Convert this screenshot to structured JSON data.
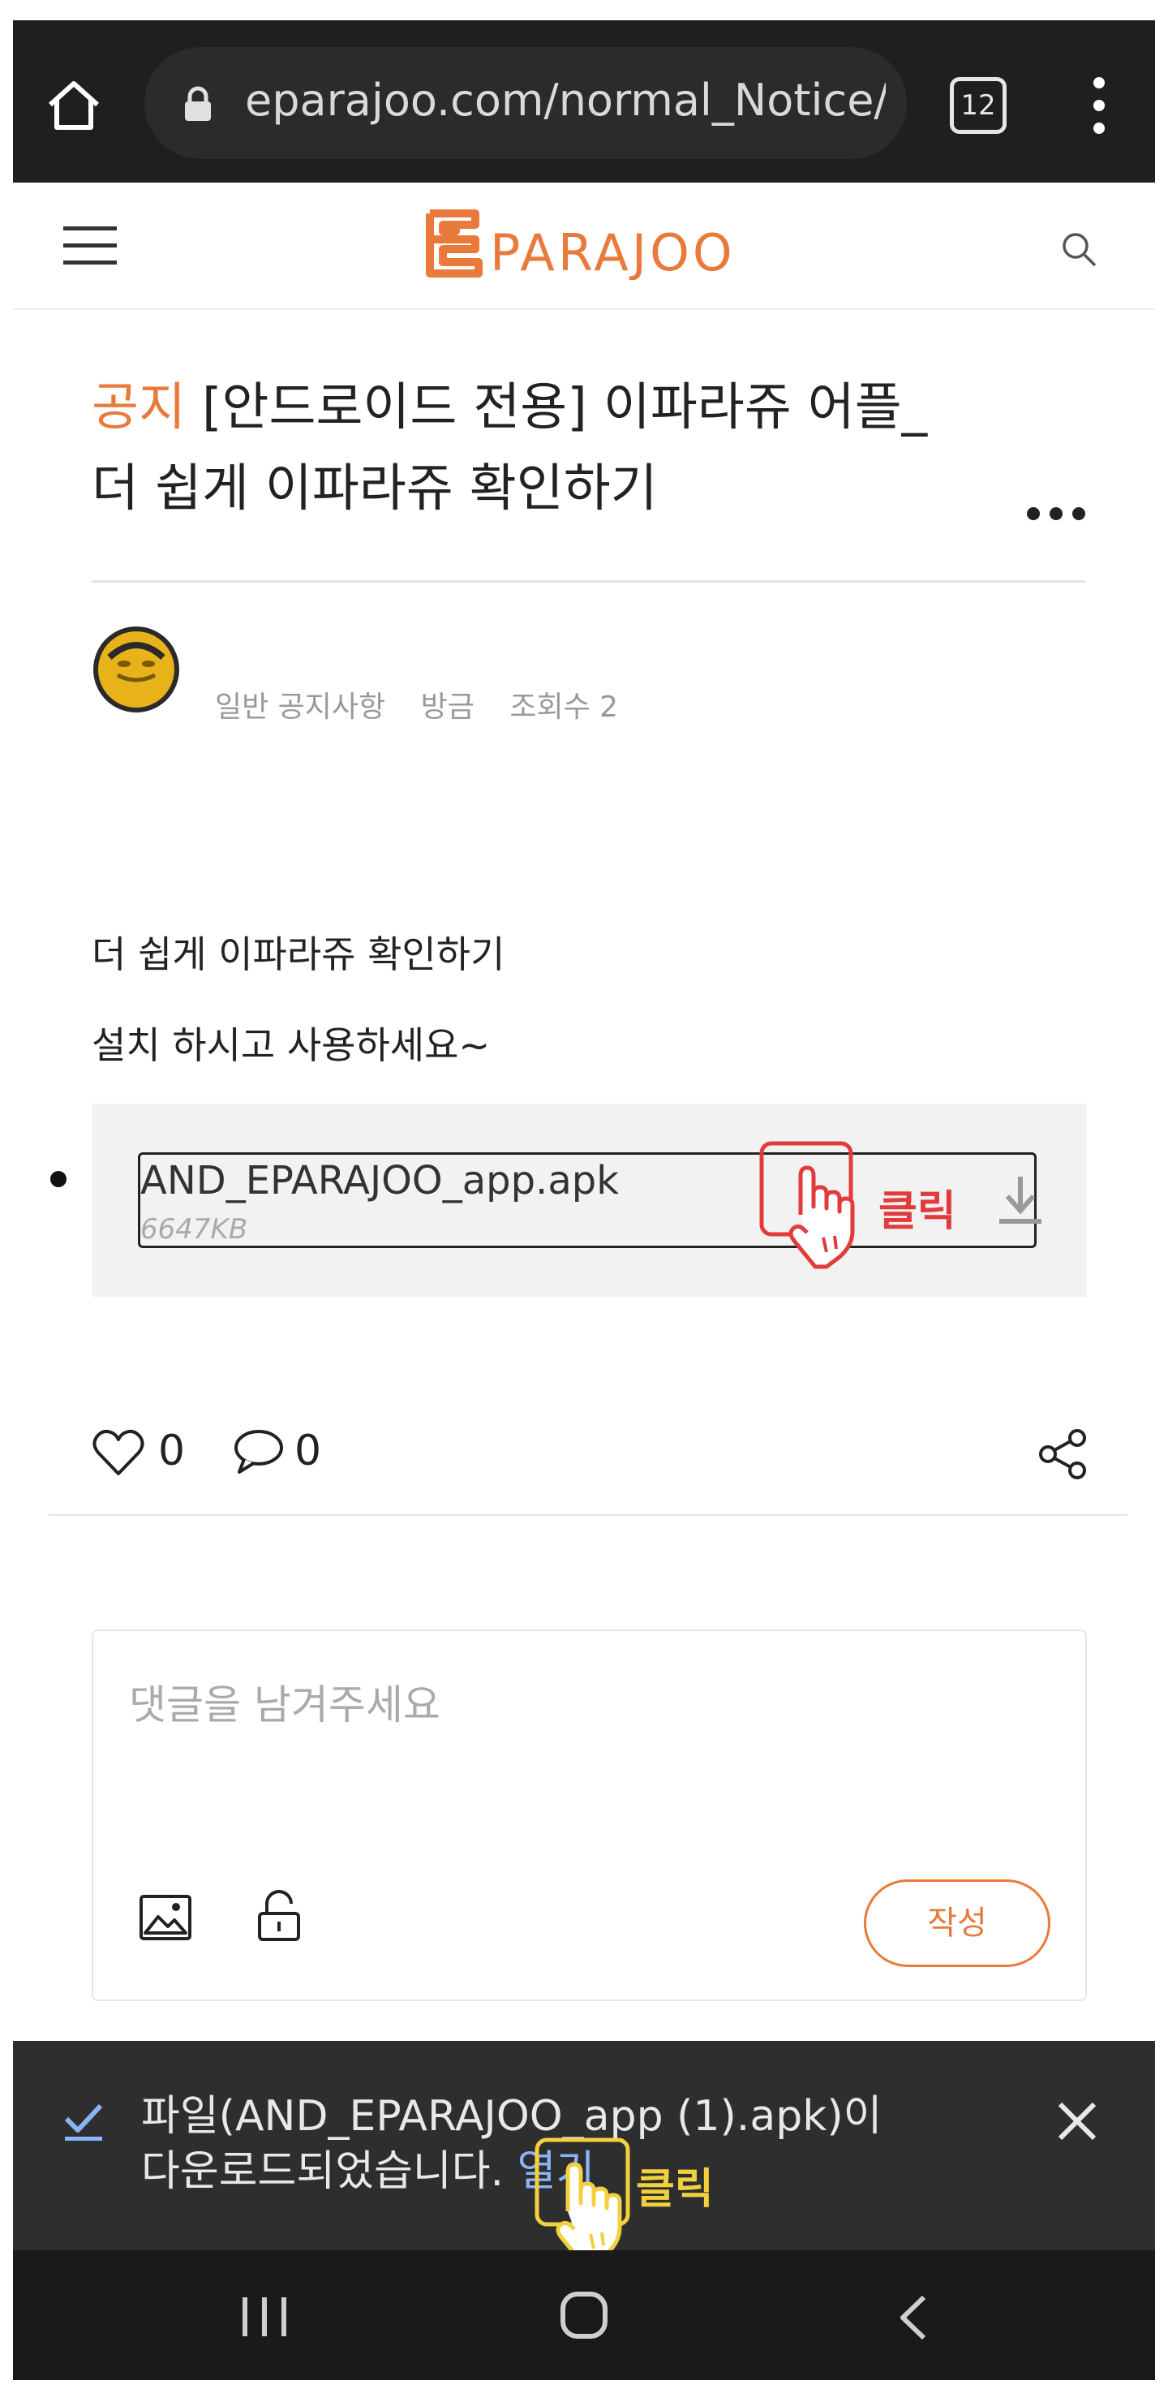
{
  "browser": {
    "url": "eparajoo.com/normal_Notice/",
    "tab_count": "12"
  },
  "site": {
    "logo_text": "EPARAJOO"
  },
  "post": {
    "badge": "공지",
    "title_part1": " [안드로이드 전용] 이파라쥬 어플_",
    "title_part2": "더 쉽게 이파라쥬 확인하기",
    "category": "일반 공지사항",
    "time": "방금",
    "views": "조회수 2",
    "body_line1": "더 쉽게 이파라쥬 확인하기",
    "body_line2": "설치 하시고 사용하세요~",
    "attachment": {
      "name": "AND_EPARAJOO_app.apk",
      "size": "6647KB"
    },
    "annotation_click": "클릭",
    "likes": "0",
    "comments": "0"
  },
  "comment_form": {
    "placeholder": "댓글을 남겨주세요",
    "submit_label": "작성"
  },
  "download_bar": {
    "line1": "파일(AND_EPARAJOO_app (1).apk)이",
    "line2": "다운로드되었습니다. ",
    "open_label": "열기",
    "annotation_click": "클릭"
  },
  "colors": {
    "accent": "#e97a3c",
    "browser_bg": "#1f1f1f",
    "download_bar_bg": "#2e2e2e",
    "link_blue": "#8ab4f8",
    "annotation_red": "#e23b3b",
    "annotation_yellow": "#f3d03e"
  },
  "icons": [
    "home-icon",
    "lock-icon",
    "more-vert-icon",
    "hamburger-icon",
    "search-icon",
    "more-horiz-icon",
    "download-icon",
    "hand-pointer-icon",
    "heart-icon",
    "comment-icon",
    "share-icon",
    "image-icon",
    "unlock-icon",
    "check-icon",
    "close-icon",
    "recents-icon",
    "home-nav-icon",
    "back-icon"
  ]
}
